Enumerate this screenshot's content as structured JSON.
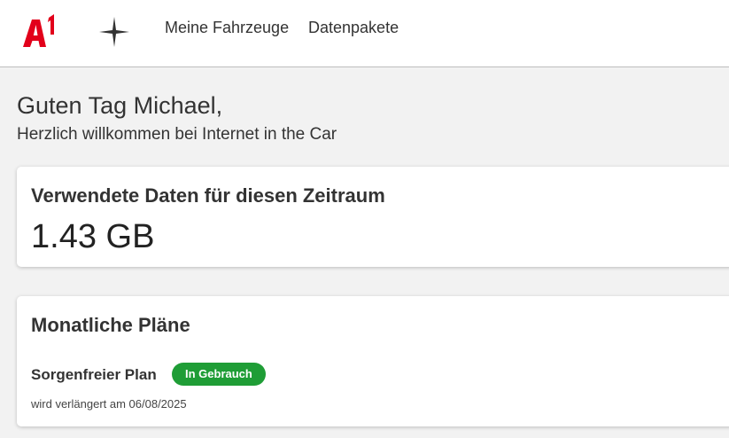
{
  "header": {
    "logo_text": "A1",
    "brand_color": "#e2001a",
    "brand_icon": "sparkle-icon",
    "nav": [
      "Meine Fahrzeuge",
      "Datenpakete"
    ]
  },
  "greeting": {
    "title": "Guten Tag Michael,",
    "subtitle": "Herzlich willkommen bei Internet in the Car"
  },
  "usage": {
    "title": "Verwendete Daten für diesen Zeitraum",
    "value": "1.43 GB"
  },
  "plans": {
    "title": "Monatliche Pläne",
    "items": [
      {
        "name": "Sorgenfreier Plan",
        "status": "In Gebrauch",
        "status_color": "#1f9d36",
        "renewal": "wird verlängert am 06/08/2025"
      }
    ]
  }
}
